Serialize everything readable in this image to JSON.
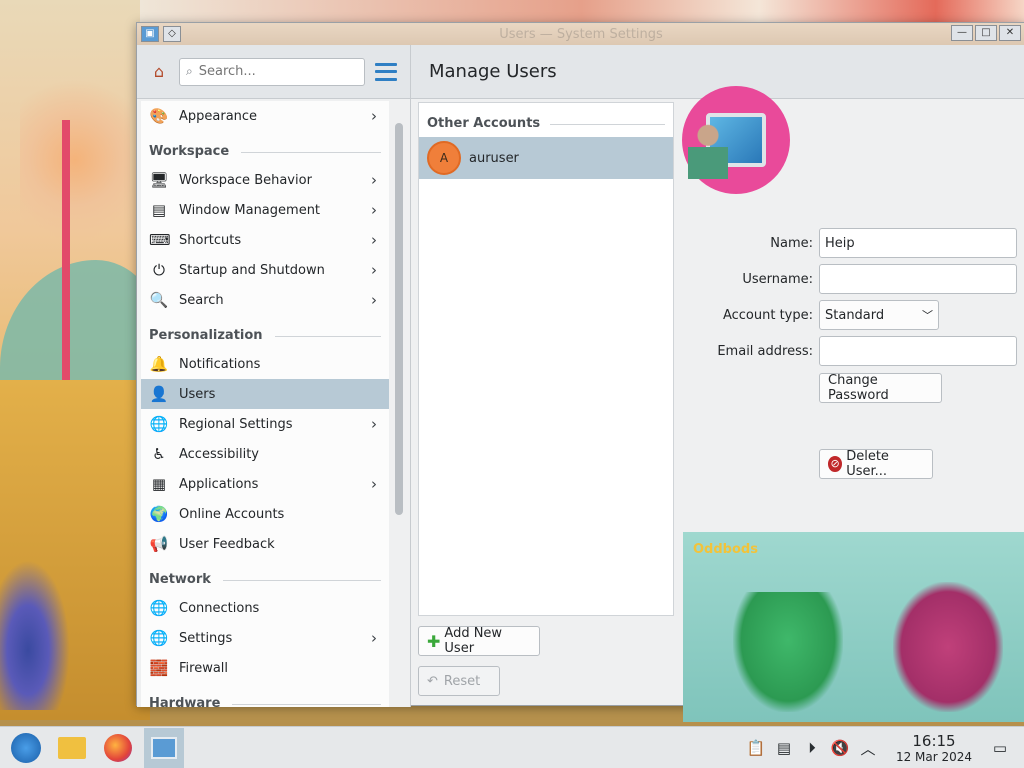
{
  "window": {
    "title": "Users — System Settings",
    "buttons": {
      "minimize": "—",
      "maximize": "□",
      "close": "✕"
    }
  },
  "sidebar": {
    "search_placeholder": "Search...",
    "items": [
      {
        "type": "item",
        "label": "Appearance",
        "icon": "appearance-icon",
        "glyph": "🎨",
        "chevron": true
      },
      {
        "type": "section",
        "label": "Workspace"
      },
      {
        "type": "item",
        "label": "Workspace Behavior",
        "icon": "workspace-icon",
        "glyph": "🖥",
        "chevron": true
      },
      {
        "type": "item",
        "label": "Window Management",
        "icon": "window-icon",
        "glyph": "▤",
        "chevron": true
      },
      {
        "type": "item",
        "label": "Shortcuts",
        "icon": "keyboard-icon",
        "glyph": "⌨",
        "chevron": true
      },
      {
        "type": "item",
        "label": "Startup and Shutdown",
        "icon": "startup-icon",
        "glyph": "⏻",
        "chevron": true
      },
      {
        "type": "item",
        "label": "Search",
        "icon": "search-icon",
        "glyph": "🔍",
        "chevron": true
      },
      {
        "type": "section",
        "label": "Personalization"
      },
      {
        "type": "item",
        "label": "Notifications",
        "icon": "bell-icon",
        "glyph": "🔔",
        "chevron": false
      },
      {
        "type": "item",
        "label": "Users",
        "icon": "users-icon",
        "glyph": "👤",
        "chevron": false,
        "active": true
      },
      {
        "type": "item",
        "label": "Regional Settings",
        "icon": "globe-icon",
        "glyph": "🌐",
        "chevron": true
      },
      {
        "type": "item",
        "label": "Accessibility",
        "icon": "accessibility-icon",
        "glyph": "♿",
        "chevron": false
      },
      {
        "type": "item",
        "label": "Applications",
        "icon": "applications-icon",
        "glyph": "▦",
        "chevron": true
      },
      {
        "type": "item",
        "label": "Online Accounts",
        "icon": "online-accounts-icon",
        "glyph": "🌍",
        "chevron": false
      },
      {
        "type": "item",
        "label": "User Feedback",
        "icon": "feedback-icon",
        "glyph": "📢",
        "chevron": false
      },
      {
        "type": "section",
        "label": "Network"
      },
      {
        "type": "item",
        "label": "Connections",
        "icon": "connections-icon",
        "glyph": "🌐",
        "chevron": false
      },
      {
        "type": "item",
        "label": "Settings",
        "icon": "network-settings-icon",
        "glyph": "🌐",
        "chevron": true
      },
      {
        "type": "item",
        "label": "Firewall",
        "icon": "firewall-icon",
        "glyph": "🧱",
        "chevron": false
      },
      {
        "type": "section",
        "label": "Hardware"
      }
    ]
  },
  "main": {
    "title": "Manage Users",
    "accounts_header": "Other Accounts",
    "accounts": [
      {
        "initial": "A",
        "name": "auruser"
      }
    ],
    "add_user_label": "Add New User",
    "reset_label": "Reset"
  },
  "details": {
    "name_label": "Name:",
    "name_value": "Heip",
    "username_label": "Username:",
    "username_value": "",
    "account_type_label": "Account type:",
    "account_type_value": "Standard",
    "email_label": "Email address:",
    "email_value": "",
    "change_password_label": "Change Password",
    "delete_user_label": "Delete User..."
  },
  "video": {
    "logo": "Oddbods"
  },
  "taskbar": {
    "time": "16:15",
    "date": "12 Mar 2024"
  },
  "colors": {
    "accent": "#2f7fc4",
    "selection": "#b7c9d5",
    "avatar_bg": "#e94a9a",
    "account_avatar": "#f07f3a"
  }
}
